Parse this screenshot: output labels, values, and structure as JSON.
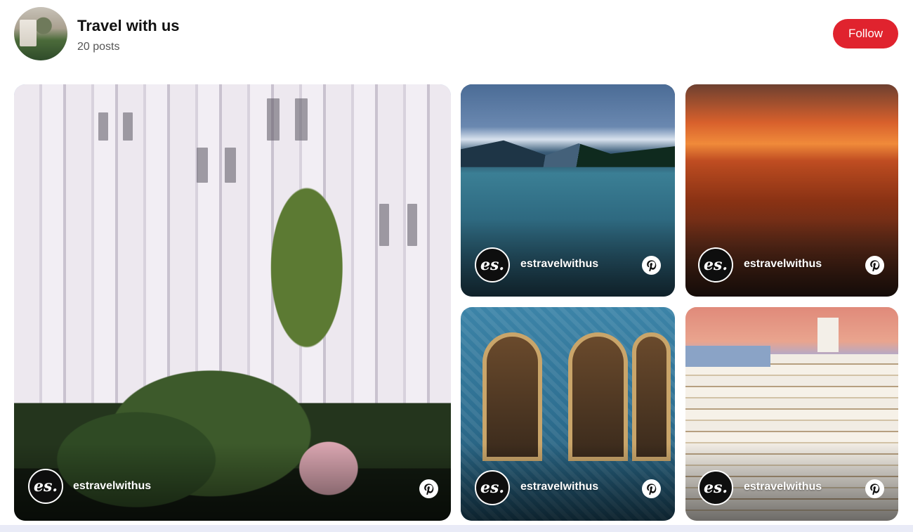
{
  "header": {
    "title": "Travel with us",
    "post_count": "20 posts",
    "follow_label": "Follow"
  },
  "tiles": [
    {
      "handle": "estravelwithus",
      "logo_text": "es.",
      "pin_icon": "pinterest-icon"
    },
    {
      "handle": "estravelwithus",
      "logo_text": "es.",
      "pin_icon": "pinterest-icon"
    },
    {
      "handle": "estravelwithus",
      "logo_text": "es.",
      "pin_icon": "pinterest-icon"
    },
    {
      "handle": "estravelwithus",
      "logo_text": "es.",
      "pin_icon": "pinterest-icon"
    },
    {
      "handle": "estravelwithus",
      "logo_text": "es.",
      "pin_icon": "pinterest-icon"
    }
  ],
  "colors": {
    "follow_button": "#e0232e",
    "logo_bg": "#0e0e0e"
  }
}
